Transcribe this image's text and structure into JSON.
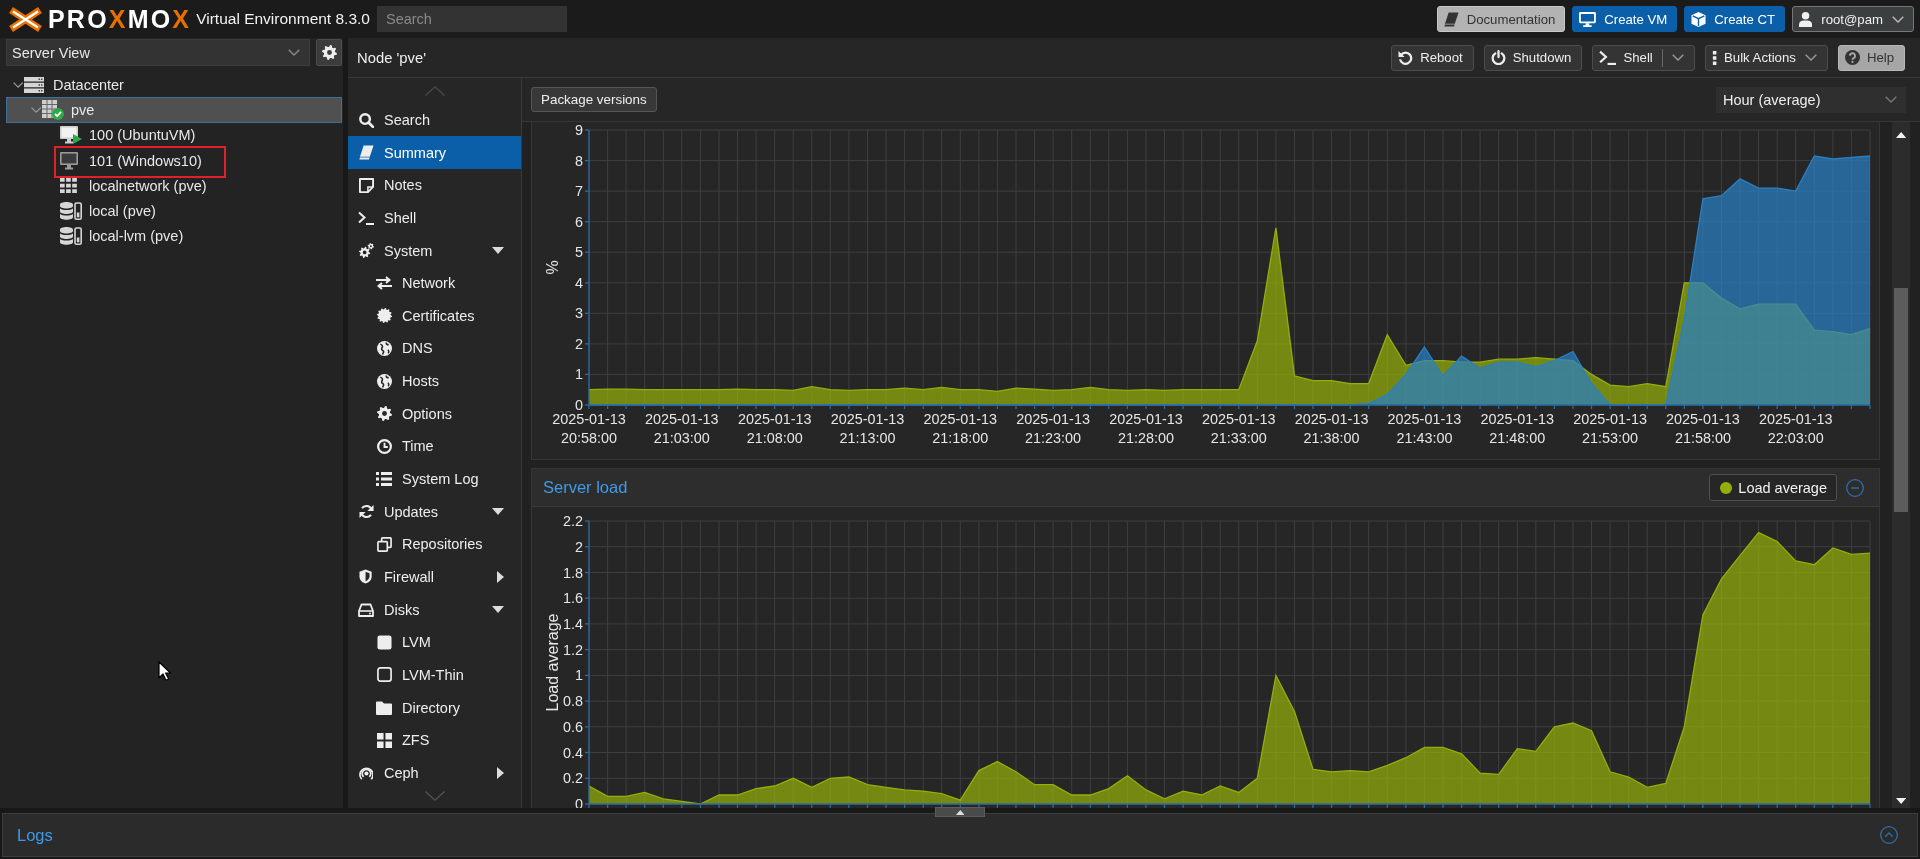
{
  "header": {
    "logo": [
      {
        "text": "PRO",
        "accent": false
      },
      {
        "text": "X",
        "accent": true
      },
      {
        "text": "MO",
        "accent": false
      },
      {
        "text": "X",
        "accent": true
      }
    ],
    "product": "Virtual Environment 8.3.0",
    "search": {
      "placeholder": "Search"
    },
    "buttons": [
      {
        "kind": "light",
        "label": "Documentation"
      },
      {
        "kind": "primary",
        "label": "Create VM"
      },
      {
        "kind": "primary",
        "label": "Create CT"
      },
      {
        "kind": "menu",
        "label": "root@pam"
      }
    ]
  },
  "sidebar": {
    "view": "Server View",
    "tree": [
      {
        "kind": "datacenter",
        "label": "Datacenter",
        "selected": false,
        "highlighted": false,
        "expanded": true,
        "children": [
          {
            "kind": "node",
            "label": "pve",
            "online": true,
            "selected": true,
            "highlighted": false,
            "expanded": true,
            "children": [
              {
                "kind": "vm",
                "label": "100 (UbuntuVM)",
                "running": true,
                "selected": false,
                "highlighted": false
              },
              {
                "kind": "vm",
                "label": "101 (Windows10)",
                "running": false,
                "selected": false,
                "highlighted": true
              },
              {
                "kind": "sdn",
                "label": "localnetwork (pve)",
                "selected": false,
                "highlighted": false
              },
              {
                "kind": "storage",
                "label": "local (pve)",
                "selected": false,
                "highlighted": false
              },
              {
                "kind": "storage",
                "label": "local-lvm (pve)",
                "selected": false,
                "highlighted": false
              }
            ]
          }
        ]
      }
    ]
  },
  "node": {
    "title": "Node 'pve'",
    "toolbar": [
      {
        "kind": "plain",
        "label": "Reboot"
      },
      {
        "kind": "plain",
        "label": "Shutdown"
      },
      {
        "kind": "split",
        "label": "Shell"
      },
      {
        "kind": "menu",
        "label": "Bulk Actions"
      },
      {
        "kind": "light",
        "label": "Help"
      }
    ]
  },
  "nav": {
    "items": [
      {
        "label": "Search",
        "selected": false
      },
      {
        "label": "Summary",
        "selected": true
      },
      {
        "label": "Notes",
        "selected": false
      },
      {
        "label": "Shell",
        "selected": false
      },
      {
        "label": "System",
        "selected": false,
        "expanded": true,
        "children": [
          {
            "label": "Network",
            "selected": false
          },
          {
            "label": "Certificates",
            "selected": false
          },
          {
            "label": "DNS",
            "selected": false
          },
          {
            "label": "Hosts",
            "selected": false
          },
          {
            "label": "Options",
            "selected": false
          },
          {
            "label": "Time",
            "selected": false
          },
          {
            "label": "System Log",
            "selected": false
          }
        ]
      },
      {
        "label": "Updates",
        "selected": false,
        "expanded": true,
        "children": [
          {
            "label": "Repositories",
            "selected": false
          }
        ]
      },
      {
        "label": "Firewall",
        "selected": false,
        "expanded": false
      },
      {
        "label": "Disks",
        "selected": false,
        "expanded": true,
        "children": [
          {
            "label": "LVM",
            "selected": false
          },
          {
            "label": "LVM-Thin",
            "selected": false
          },
          {
            "label": "Directory",
            "selected": false
          },
          {
            "label": "ZFS",
            "selected": false
          }
        ]
      },
      {
        "label": "Ceph",
        "selected": false,
        "expanded": false
      }
    ]
  },
  "summary": {
    "button": "Package versions",
    "timeframe": "Hour (average)",
    "charts": [
      {
        "chart_data": {
          "type": "area",
          "ylabel": "%",
          "grid": true,
          "ylim": [
            0,
            9
          ],
          "yticks": [
            0,
            1,
            2,
            3,
            4,
            5,
            6,
            7,
            8,
            9
          ],
          "categories": [
            "2025-01-13\n20:58:00",
            null,
            null,
            null,
            null,
            "2025-01-13\n21:03:00",
            null,
            null,
            null,
            null,
            "2025-01-13\n21:08:00",
            null,
            null,
            null,
            null,
            "2025-01-13\n21:13:00",
            null,
            null,
            null,
            null,
            "2025-01-13\n21:18:00",
            null,
            null,
            null,
            null,
            "2025-01-13\n21:23:00",
            null,
            null,
            null,
            null,
            "2025-01-13\n21:28:00",
            null,
            null,
            null,
            null,
            "2025-01-13\n21:33:00",
            null,
            null,
            null,
            null,
            "2025-01-13\n21:38:00",
            null,
            null,
            null,
            null,
            "2025-01-13\n21:43:00",
            null,
            null,
            null,
            null,
            "2025-01-13\n21:48:00",
            null,
            null,
            null,
            null,
            "2025-01-13\n21:53:00",
            null,
            null,
            null,
            null,
            "2025-01-13\n21:58:00",
            null,
            null,
            null,
            null,
            "2025-01-13\n22:03:00",
            null,
            null,
            null,
            null
          ],
          "series": [
            {
              "color": "#94ae0a",
              "values": [
                0.5,
                0.52,
                0.52,
                0.5,
                0.5,
                0.5,
                0.5,
                0.5,
                0.52,
                0.5,
                0.5,
                0.48,
                0.6,
                0.5,
                0.48,
                0.5,
                0.5,
                0.55,
                0.5,
                0.58,
                0.5,
                0.5,
                0.45,
                0.55,
                0.52,
                0.48,
                0.5,
                0.58,
                0.5,
                0.48,
                0.5,
                0.48,
                0.5,
                0.5,
                0.5,
                0.5,
                2.1,
                5.8,
                0.95,
                0.8,
                0.8,
                0.7,
                0.7,
                2.3,
                1.3,
                1.45,
                1.45,
                1.4,
                1.4,
                1.5,
                1.5,
                1.55,
                1.5,
                1.45,
                1.0,
                0.65,
                0.6,
                0.7,
                0.6,
                4.0,
                4.0,
                3.5,
                3.15,
                3.3,
                3.3,
                3.3,
                2.45,
                2.4,
                2.3,
                2.5
              ]
            },
            {
              "color": "#2a7fc4",
              "values": [
                0,
                0,
                0,
                0,
                0,
                0,
                0,
                0,
                0,
                0,
                0,
                0,
                0,
                0,
                0,
                0,
                0,
                0,
                0,
                0,
                0,
                0,
                0,
                0,
                0,
                0,
                0,
                0,
                0,
                0,
                0,
                0,
                0,
                0,
                0,
                0,
                0,
                0,
                0,
                0,
                0,
                0,
                0.05,
                0.35,
                1.0,
                1.9,
                0.95,
                1.6,
                1.2,
                1.4,
                1.4,
                1.25,
                1.45,
                1.75,
                0.7,
                0,
                0,
                0,
                0,
                2.8,
                6.75,
                6.85,
                7.4,
                7.1,
                7.1,
                7.0,
                8.15,
                8.05,
                8.1,
                8.15
              ]
            }
          ]
        }
      },
      {
        "title": "Server load",
        "chart_data": {
          "type": "area",
          "ylabel": "Load average",
          "grid": true,
          "ylim": [
            0,
            2.2
          ],
          "yticks": [
            0,
            0.2,
            0.4,
            0.6,
            0.8,
            1,
            1.2,
            1.4,
            1.6,
            1.8,
            2,
            2.2
          ],
          "categories": [
            null,
            null,
            null,
            null,
            null,
            null,
            null,
            null,
            null,
            null,
            null,
            null,
            null,
            null,
            null,
            null,
            null,
            null,
            null,
            null,
            null,
            null,
            null,
            null,
            null,
            null,
            null,
            null,
            null,
            null,
            null,
            null,
            null,
            null,
            null,
            null,
            null,
            null,
            null,
            null,
            null,
            null,
            null,
            null,
            null,
            null,
            null,
            null,
            null,
            null,
            null,
            null,
            null,
            null,
            null,
            null,
            null,
            null,
            null,
            null,
            null,
            null,
            null,
            null,
            null,
            null,
            null,
            null,
            null,
            null
          ],
          "series": [
            {
              "name": "Load average",
              "color": "#94ae0a",
              "values": [
                0.14,
                0.06,
                0.06,
                0.09,
                0.04,
                0.02,
                0,
                0.07,
                0.07,
                0.12,
                0.14,
                0.2,
                0.13,
                0.2,
                0.21,
                0.15,
                0.13,
                0.11,
                0.1,
                0.08,
                0.03,
                0.26,
                0.33,
                0.25,
                0.15,
                0.15,
                0.07,
                0.07,
                0.12,
                0.22,
                0.11,
                0.04,
                0.1,
                0.07,
                0.14,
                0.09,
                0.2,
                1.0,
                0.72,
                0.27,
                0.25,
                0.26,
                0.25,
                0.3,
                0.36,
                0.44,
                0.44,
                0.39,
                0.24,
                0.23,
                0.43,
                0.41,
                0.6,
                0.63,
                0.57,
                0.25,
                0.21,
                0.13,
                0.16,
                0.6,
                1.47,
                1.75,
                1.93,
                2.11,
                2.04,
                1.89,
                1.86,
                1.99,
                1.94,
                1.95
              ]
            }
          ]
        }
      }
    ]
  },
  "logs": {
    "title": "Logs",
    "expanded": false
  }
}
